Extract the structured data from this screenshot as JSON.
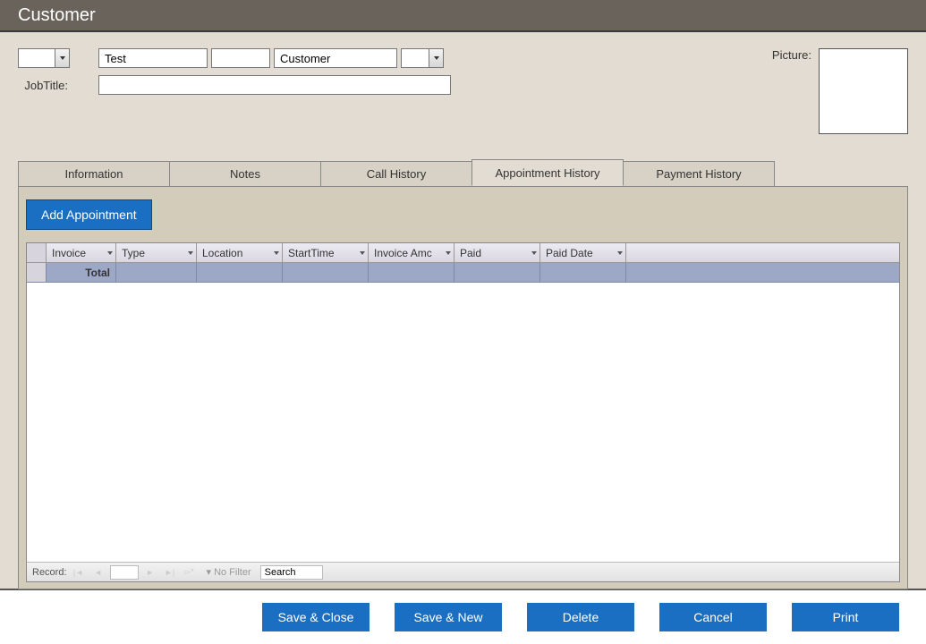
{
  "title": "Customer",
  "labels": {
    "job_title": "JobTitle:",
    "picture": "Picture:"
  },
  "fields": {
    "prefix": "",
    "first_name": "Test",
    "middle": "",
    "last_name": "Customer",
    "suffix": "",
    "job_title": ""
  },
  "tabs": {
    "information": "Information",
    "notes": "Notes",
    "call_history": "Call History",
    "appointment_history": "Appointment History",
    "payment_history": "Payment History"
  },
  "active_tab": "appointment_history",
  "appointment_tab": {
    "add_button": "Add Appointment",
    "columns": {
      "invoice": "Invoice",
      "type": "Type",
      "location": "Location",
      "start_time": "StartTime",
      "invoice_amt": "Invoice Amc",
      "paid": "Paid",
      "paid_date": "Paid Date"
    },
    "total_row_label": "Total",
    "record_nav": {
      "label": "Record:",
      "current": "",
      "no_filter": "No Filter",
      "search_placeholder": "Search"
    }
  },
  "buttons": {
    "save_close": "Save & Close",
    "save_new": "Save & New",
    "delete": "Delete",
    "cancel": "Cancel",
    "print": "Print"
  }
}
